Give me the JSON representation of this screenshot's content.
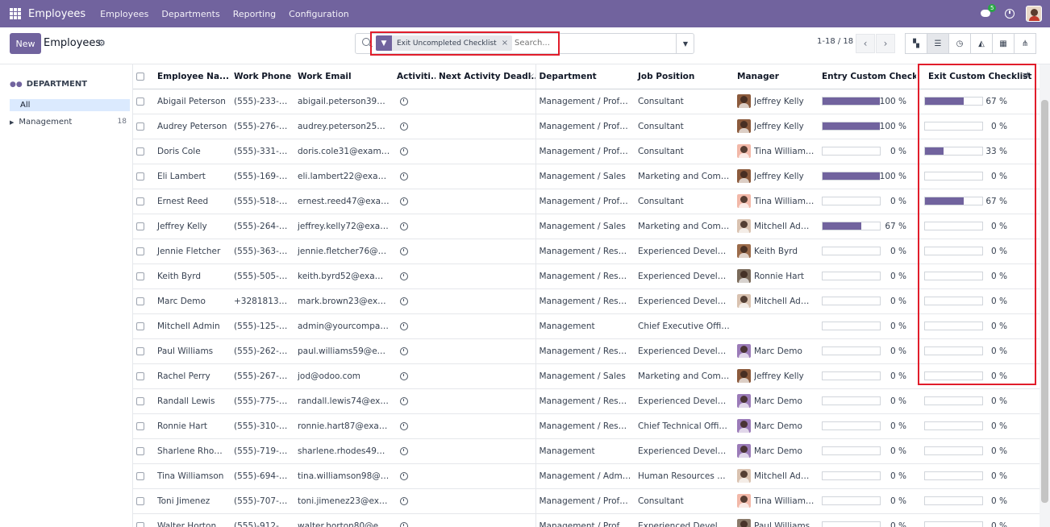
{
  "navbar": {
    "brand": "Employees",
    "menu": [
      "Employees",
      "Departments",
      "Reporting",
      "Configuration"
    ],
    "message_count": "5"
  },
  "control": {
    "new_label": "New",
    "title": "Employees",
    "facet_label": "Exit Uncompleted Checklist",
    "search_placeholder": "Search...",
    "pager": "1-18 / 18"
  },
  "sidebar": {
    "title": "DEPARTMENT",
    "all_label": "All",
    "items": [
      {
        "label": "Management",
        "count": "18"
      }
    ]
  },
  "table": {
    "headers": {
      "name": "Employee Na...",
      "phone": "Work Phone",
      "email": "Work Email",
      "activity": "Activiti...",
      "deadline": "Next Activity Deadl...",
      "department": "Department",
      "job": "Job Position",
      "manager": "Manager",
      "entry": "Entry Custom Checklist",
      "exit": "Exit Custom Checklist"
    },
    "rows": [
      {
        "name": "Abigail Peterson",
        "phone": "(555)-233-3393",
        "email": "abigail.peterson39@e...",
        "dept": "Management / Profes...",
        "job": "Consultant",
        "manager": "Jeffrey Kelly",
        "mgr_color": "#8b5a3c",
        "entry": 100,
        "entry_label": "100 %",
        "exit": 67,
        "exit_label": "67 %"
      },
      {
        "name": "Audrey Peterson",
        "phone": "(555)-276-7903",
        "email": "audrey.peterson25@e...",
        "dept": "Management / Profes...",
        "job": "Consultant",
        "manager": "Jeffrey Kelly",
        "mgr_color": "#8b5a3c",
        "entry": 100,
        "entry_label": "100 %",
        "exit": 0,
        "exit_label": "0 %"
      },
      {
        "name": "Doris Cole",
        "phone": "(555)-331-5378",
        "email": "doris.cole31@exampl...",
        "dept": "Management / Profes...",
        "job": "Consultant",
        "manager": "Tina Williams...",
        "mgr_color": "#f2b8a8",
        "entry": 0,
        "entry_label": "0 %",
        "exit": 33,
        "exit_label": "33 %"
      },
      {
        "name": "Eli Lambert",
        "phone": "(555)-169-1352",
        "email": "eli.lambert22@exam...",
        "dept": "Management / Sales",
        "job": "Marketing and Comm...",
        "manager": "Jeffrey Kelly",
        "mgr_color": "#8b5a3c",
        "entry": 100,
        "entry_label": "100 %",
        "exit": 0,
        "exit_label": "0 %"
      },
      {
        "name": "Ernest Reed",
        "phone": "(555)-518-8232",
        "email": "ernest.reed47@exam...",
        "dept": "Management / Profes...",
        "job": "Consultant",
        "manager": "Tina Williams...",
        "mgr_color": "#f2b8a8",
        "entry": 0,
        "entry_label": "0 %",
        "exit": 67,
        "exit_label": "67 %"
      },
      {
        "name": "Jeffrey Kelly",
        "phone": "(555)-264-7362",
        "email": "jeffrey.kelly72@exam...",
        "dept": "Management / Sales",
        "job": "Marketing and Comm...",
        "manager": "Mitchell Admin",
        "mgr_color": "#d9c2b0",
        "entry": 67,
        "entry_label": "67 %",
        "exit": 0,
        "exit_label": "0 %"
      },
      {
        "name": "Jennie Fletcher",
        "phone": "(555)-363-8229",
        "email": "jennie.fletcher76@ex...",
        "dept": "Management / Resear...",
        "job": "Experienced Developer",
        "manager": "Keith Byrd",
        "mgr_color": "#9b6b4a",
        "entry": 0,
        "entry_label": "0 %",
        "exit": 0,
        "exit_label": "0 %"
      },
      {
        "name": "Keith Byrd",
        "phone": "(555)-505-5146",
        "email": "keith.byrd52@exampl...",
        "dept": "Management / Resear...",
        "job": "Experienced Developer",
        "manager": "Ronnie Hart",
        "mgr_color": "#7a6a5a",
        "entry": 0,
        "entry_label": "0 %",
        "exit": 0,
        "exit_label": "0 %"
      },
      {
        "name": "Marc Demo",
        "phone": "+3281813700",
        "email": "mark.brown23@exam...",
        "dept": "Management / Resear...",
        "job": "Experienced Developer",
        "manager": "Mitchell Admin",
        "mgr_color": "#d9c2b0",
        "entry": 0,
        "entry_label": "0 %",
        "exit": 0,
        "exit_label": "0 %"
      },
      {
        "name": "Mitchell Admin",
        "phone": "(555)-125-2389",
        "email": "admin@yourcompany....",
        "dept": "Management",
        "job": "Chief Executive Officer",
        "manager": "",
        "mgr_color": "",
        "entry": 0,
        "entry_label": "0 %",
        "exit": 0,
        "exit_label": "0 %"
      },
      {
        "name": "Paul Williams",
        "phone": "(555)-262-1607",
        "email": "paul.williams59@exa...",
        "dept": "Management / Resear...",
        "job": "Experienced Developer",
        "manager": "Marc Demo",
        "mgr_color": "#9b7bb8",
        "entry": 0,
        "entry_label": "0 %",
        "exit": 0,
        "exit_label": "0 %"
      },
      {
        "name": "Rachel Perry",
        "phone": "(555)-267-3735",
        "email": "jod@odoo.com",
        "dept": "Management / Sales",
        "job": "Marketing and Comm...",
        "manager": "Jeffrey Kelly",
        "mgr_color": "#8b5a3c",
        "entry": 0,
        "entry_label": "0 %",
        "exit": 0,
        "exit_label": "0 %"
      },
      {
        "name": "Randall Lewis",
        "phone": "(555)-775-6660",
        "email": "randall.lewis74@exa...",
        "dept": "Management / Resear...",
        "job": "Experienced Developer",
        "manager": "Marc Demo",
        "mgr_color": "#9b7bb8",
        "entry": 0,
        "entry_label": "0 %",
        "exit": 0,
        "exit_label": "0 %"
      },
      {
        "name": "Ronnie Hart",
        "phone": "(555)-310-7863",
        "email": "ronnie.hart87@exam...",
        "dept": "Management / Resear...",
        "job": "Chief Technical Officer",
        "manager": "Marc Demo",
        "mgr_color": "#9b7bb8",
        "entry": 0,
        "entry_label": "0 %",
        "exit": 0,
        "exit_label": "0 %"
      },
      {
        "name": "Sharlene Rhodes",
        "phone": "(555)-719-4182",
        "email": "sharlene.rhodes49@e...",
        "dept": "Management",
        "job": "Experienced Developer",
        "manager": "Marc Demo",
        "mgr_color": "#9b7bb8",
        "entry": 0,
        "entry_label": "0 %",
        "exit": 0,
        "exit_label": "0 %"
      },
      {
        "name": "Tina Williamson",
        "phone": "(555)-694-7266",
        "email": "tina.williamson98@ex...",
        "dept": "Management / Admin...",
        "job": "Human Resources Ma...",
        "manager": "Mitchell Admin",
        "mgr_color": "#d9c2b0",
        "entry": 0,
        "entry_label": "0 %",
        "exit": 0,
        "exit_label": "0 %"
      },
      {
        "name": "Toni Jimenez",
        "phone": "(555)-707-8451",
        "email": "toni.jimenez23@exa...",
        "dept": "Management / Profes...",
        "job": "Consultant",
        "manager": "Tina Williams...",
        "mgr_color": "#f2b8a8",
        "entry": 0,
        "entry_label": "0 %",
        "exit": 0,
        "exit_label": "0 %"
      },
      {
        "name": "Walter Horton",
        "phone": "(555)-912-1201",
        "email": "walter.horton80@exa...",
        "dept": "Management / Profes...",
        "job": "Experienced Developer",
        "manager": "Paul Williams",
        "mgr_color": "#8a7a6a",
        "entry": 0,
        "entry_label": "0 %",
        "exit": 0,
        "exit_label": "0 %"
      }
    ]
  },
  "colors": {
    "brand": "#71639e",
    "highlight": "#e11d2b"
  }
}
